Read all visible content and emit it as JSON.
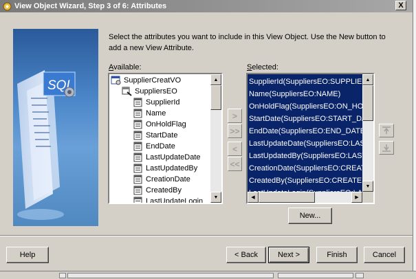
{
  "window": {
    "title": "View Object Wizard, Step 3 of 6: Attributes",
    "close_label": "X"
  },
  "instruction": "Select the attributes you want to include in this View Object.  Use the New button to add a new View Attribute.",
  "available": {
    "label": "Available:",
    "root": "SupplierCreatVO",
    "entity": "SuppliersEO",
    "attributes": [
      "SupplierId",
      "Name",
      "OnHoldFlag",
      "StartDate",
      "EndDate",
      "LastUpdateDate",
      "LastUpdatedBy",
      "CreationDate",
      "CreatedBy",
      "LastUpdateLogin"
    ]
  },
  "selected": {
    "label": "Selected:",
    "items": [
      "SupplierId(SuppliersEO:SUPPLIER_",
      "Name(SuppliersEO:NAME)",
      "OnHoldFlag(SuppliersEO:ON_HOLD",
      "StartDate(SuppliersEO:START_DA",
      "EndDate(SuppliersEO:END_DATE)",
      "LastUpdateDate(SuppliersEO:LAST",
      "LastUpdatedBy(SuppliersEO:LAST",
      "CreationDate(SuppliersEO:CREATIO",
      "CreatedBy(SuppliersEO:CREATED_",
      "LastUpdateLogin(SuppliersEO:LAS"
    ]
  },
  "buttons": {
    "new": "New...",
    "help": "Help",
    "back": "< Back",
    "next": "Next >",
    "finish": "Finish",
    "cancel": "Cancel"
  },
  "banner": {
    "sql_text": "SQL"
  }
}
